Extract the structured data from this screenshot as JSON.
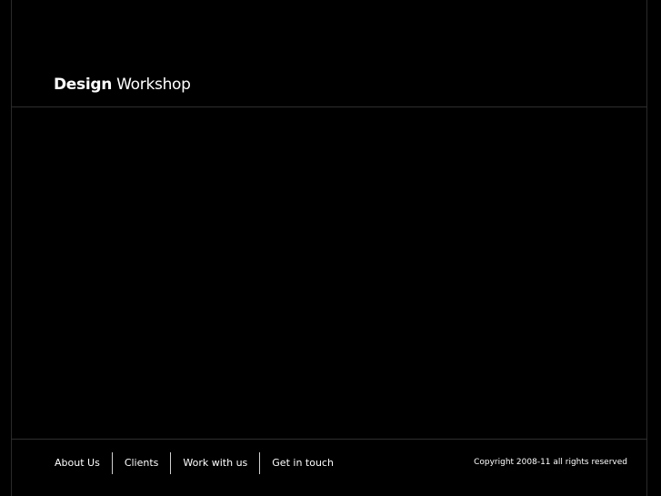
{
  "colors": {
    "background": "#000000",
    "text": "#ffffff",
    "divider": "#2e2e2e"
  },
  "header": {
    "logo_bold": "Design",
    "logo_light": "Workshop"
  },
  "footer": {
    "nav": [
      {
        "label": "About Us"
      },
      {
        "label": "Clients"
      },
      {
        "label": "Work with us"
      },
      {
        "label": "Get in touch"
      }
    ],
    "copyright": "Copyright 2008-11 all rights reserved"
  }
}
